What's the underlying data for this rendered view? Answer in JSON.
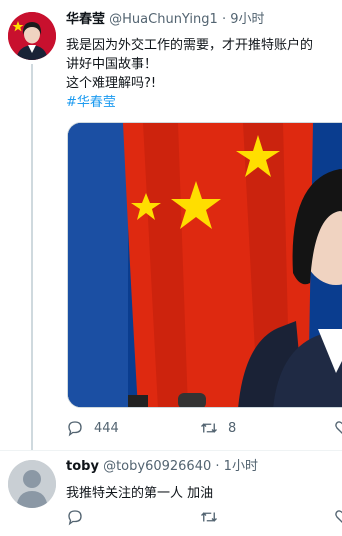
{
  "tweet": {
    "display_name": "华春莹",
    "handle": "@HuaChunYing1",
    "separator": "·",
    "time": "9小时",
    "text_lines": [
      "我是因为外交工作的需要，才开推特账户的",
      "讲好中国故事！",
      "这个难理解吗?!"
    ],
    "hashtag": "#华春莹",
    "reply_count": "444",
    "retweet_count": "8",
    "icons": [
      "reply-icon",
      "retweet-icon",
      "like-icon"
    ]
  },
  "reply": {
    "display_name": "toby",
    "handle": "@toby60926640",
    "separator": "·",
    "time": "1小时",
    "text": "我推特关注的第一人 加油"
  },
  "colors": {
    "accent": "#1d9bf0",
    "text": "#0f1419",
    "secondary": "#536471",
    "flag_red": "#de2910",
    "flag_yellow": "#ffde00",
    "backdrop_blue": "#0a3d8f"
  }
}
